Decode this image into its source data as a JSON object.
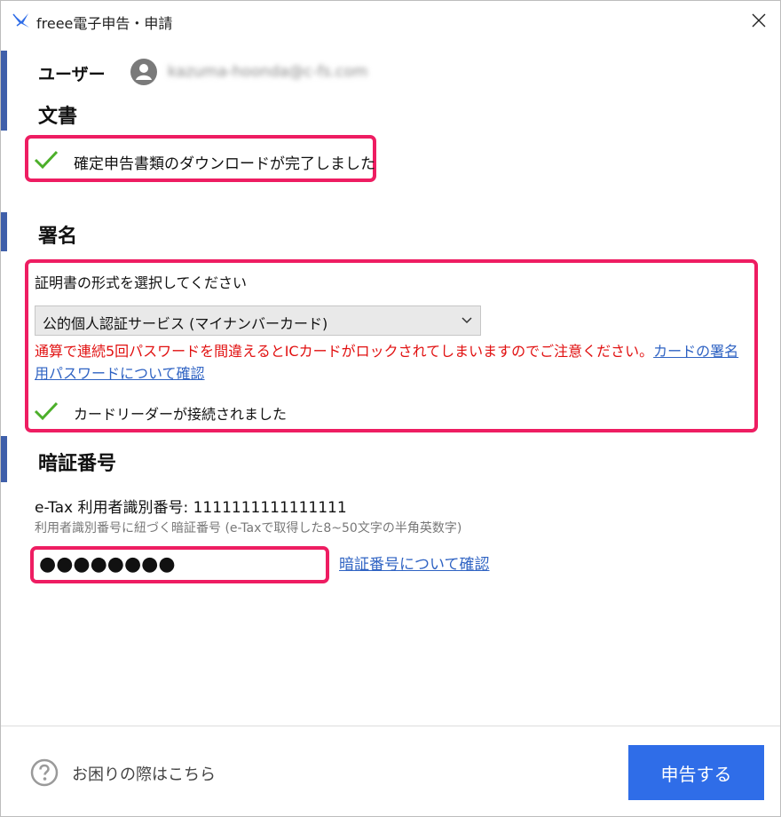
{
  "window": {
    "title": "freee電子申告・申請",
    "icon": "freee-bird-icon",
    "close_icon": "close-icon"
  },
  "user": {
    "label": "ユーザー",
    "email": "kazuma-hoonda@c-fs.com"
  },
  "document": {
    "title": "文書",
    "status": "確定申告書類のダウンロードが完了しました"
  },
  "signature": {
    "title": "署名",
    "cert_label": "証明書の形式を選択してください",
    "cert_selected": "公的個人認証サービス (マイナンバーカード)",
    "warning_text": "通算で連続5回パスワードを間違えるとICカードがロックされてしまいますのでご注意ください。",
    "warning_link": "カードの署名用パスワードについて確認",
    "reader_status": "カードリーダーが接続されました"
  },
  "pin": {
    "title": "暗証番号",
    "etax_id": "e-Tax 利用者識別番号: 1111111111111111",
    "hint": "利用者識別番号に紐づく暗証番号 (e-Taxで取得した8~50文字の半角英数字)",
    "value": "●●●●●●●●",
    "link": "暗証番号について確認"
  },
  "footer": {
    "help_text": "お困りの際はこちら",
    "submit_label": "申告する"
  },
  "colors": {
    "highlight": "#ee1d62",
    "accent": "#3f5faa",
    "primary_button": "#2f6de8",
    "link": "#2f63c3",
    "warning": "#e11010",
    "check": "#4caf2a"
  }
}
